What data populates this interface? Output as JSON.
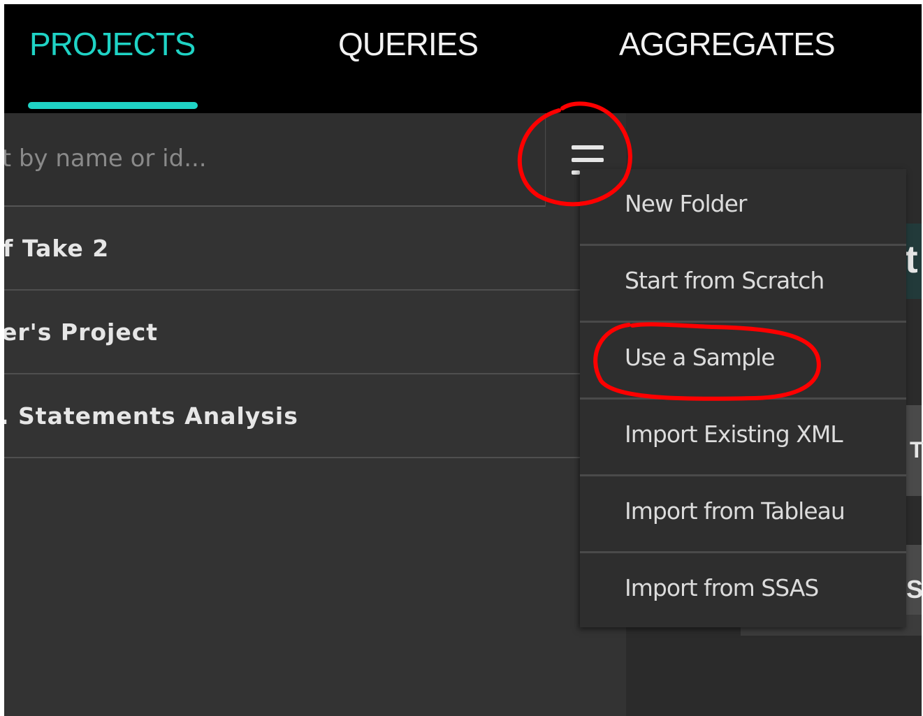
{
  "nav": {
    "tabs": [
      {
        "label": "PROJECTS",
        "active": true
      },
      {
        "label": "QUERIES",
        "active": false
      },
      {
        "label": "AGGREGATES",
        "active": false
      }
    ],
    "accent_color": "#1fd3c5"
  },
  "search": {
    "placeholder": "ct by name or id..."
  },
  "menu_button": {
    "icon": "hamburger-menu-icon"
  },
  "projects": [
    {
      "name": "f Take 2"
    },
    {
      "name": "er's Project"
    },
    {
      "name": ". Statements Analysis"
    }
  ],
  "dropdown": {
    "items": [
      {
        "label": "New Folder"
      },
      {
        "label": "Start from Scratch"
      },
      {
        "label": "Use a Sample"
      },
      {
        "label": "Import Existing XML"
      },
      {
        "label": "Import from Tableau"
      },
      {
        "label": "Import from SSAS"
      }
    ]
  },
  "background_fragments": [
    "t",
    "T",
    "S"
  ],
  "annotation_color": "#ff0000"
}
